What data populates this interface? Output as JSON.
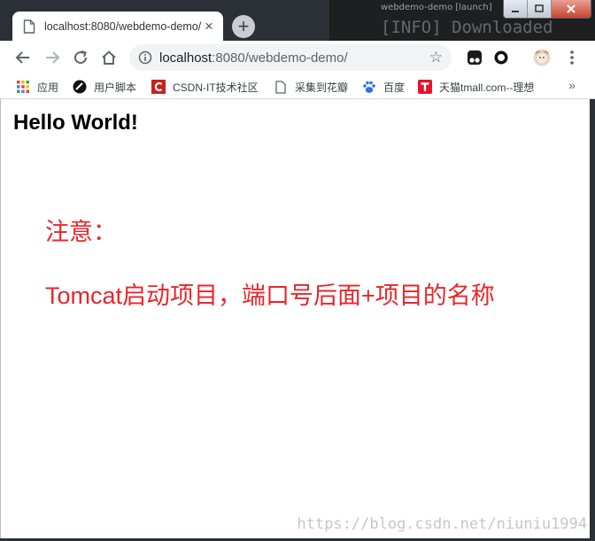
{
  "background_window": {
    "title": "webdemo-demo [launch]",
    "line": "[INFO] Downloaded"
  },
  "tab": {
    "title": "localhost:8080/webdemo-demo/"
  },
  "omnibox": {
    "host": "localhost",
    "path": ":8080/webdemo-demo/"
  },
  "bookmarks": {
    "items": [
      {
        "label": "应用",
        "icon": "apps-grid-icon"
      },
      {
        "label": "用户脚本",
        "icon": "userscript-icon"
      },
      {
        "label": "CSDN-IT技术社区",
        "icon": "csdn-icon"
      },
      {
        "label": "采集到花瓣",
        "icon": "page-icon"
      },
      {
        "label": "百度",
        "icon": "baidu-paw-icon"
      },
      {
        "label": "天猫tmall.com--理想",
        "icon": "tmall-icon"
      }
    ],
    "more": "»"
  },
  "page": {
    "heading": "Hello World!",
    "note_label": "注意：",
    "note_text": "Tomcat启动项目，端口号后面+项目的名称",
    "watermark": "https://blog.csdn.net/niuniu1994"
  },
  "colors": {
    "note_red": "#e8262b",
    "omnibox_bg": "#f1f3f4"
  }
}
